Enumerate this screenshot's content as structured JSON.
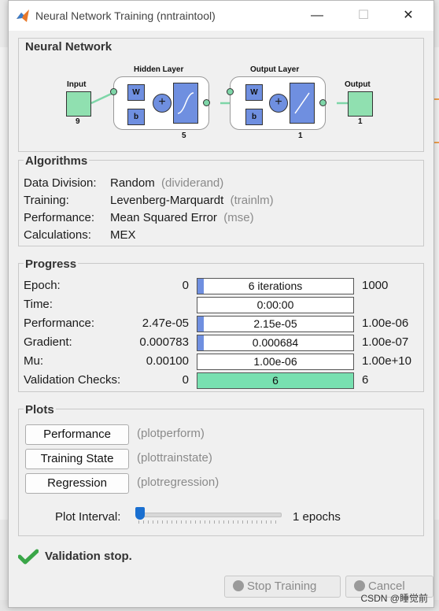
{
  "window": {
    "title": "Neural Network Training (nntraintool)"
  },
  "titlebar": {
    "minimize": "—",
    "maximize": "☐",
    "close": "✕"
  },
  "network": {
    "section_title": "Neural Network",
    "input_label": "Input",
    "input_size": "9",
    "hidden_label": "Hidden Layer",
    "hidden_size": "5",
    "output_layer_label": "Output Layer",
    "output_layer_size": "1",
    "output_label": "Output",
    "output_size": "1",
    "w": "W",
    "b": "b",
    "plus": "+"
  },
  "algorithms": {
    "section_title": "Algorithms",
    "rows": [
      {
        "label": "Data Division:",
        "value": "Random",
        "detail": "(dividerand)"
      },
      {
        "label": "Training:",
        "value": "Levenberg-Marquardt",
        "detail": "(trainlm)"
      },
      {
        "label": "Performance:",
        "value": "Mean Squared Error",
        "detail": "(mse)"
      },
      {
        "label": "Calculations:",
        "value": "MEX",
        "detail": ""
      }
    ]
  },
  "progress": {
    "section_title": "Progress",
    "rows": [
      {
        "label": "Epoch:",
        "start": "0",
        "current": "6 iterations",
        "end": "1000",
        "fill": 0.006
      },
      {
        "label": "Time:",
        "start": "",
        "current": "0:00:00",
        "end": "",
        "fill": 0
      },
      {
        "label": "Performance:",
        "start": "2.47e-05",
        "current": "2.15e-05",
        "end": "1.00e-06",
        "fill": 0.04
      },
      {
        "label": "Gradient:",
        "start": "0.000783",
        "current": "0.000684",
        "end": "1.00e-07",
        "fill": 0.04
      },
      {
        "label": "Mu:",
        "start": "0.00100",
        "current": "1.00e-06",
        "end": "1.00e+10",
        "fill": 0
      },
      {
        "label": "Validation Checks:",
        "start": "0",
        "current": "6",
        "end": "6",
        "fill": 1.0
      }
    ]
  },
  "plots": {
    "section_title": "Plots",
    "buttons": [
      {
        "label": "Performance",
        "fn": "(plotperform)"
      },
      {
        "label": "Training State",
        "fn": "(plottrainstate)"
      },
      {
        "label": "Regression",
        "fn": "(plotregression)"
      }
    ],
    "interval_label": "Plot Interval:",
    "interval_value": "1 epochs",
    "interval_fraction": 0.0
  },
  "status": {
    "text": "Validation stop."
  },
  "actions": {
    "stop": "Stop Training",
    "cancel": "Cancel"
  },
  "watermark": "CSDN @睡觉前",
  "colors": {
    "accent_blue": "#6f8fe0",
    "node_green": "#90e0b0",
    "check_green": "#3aa648"
  }
}
